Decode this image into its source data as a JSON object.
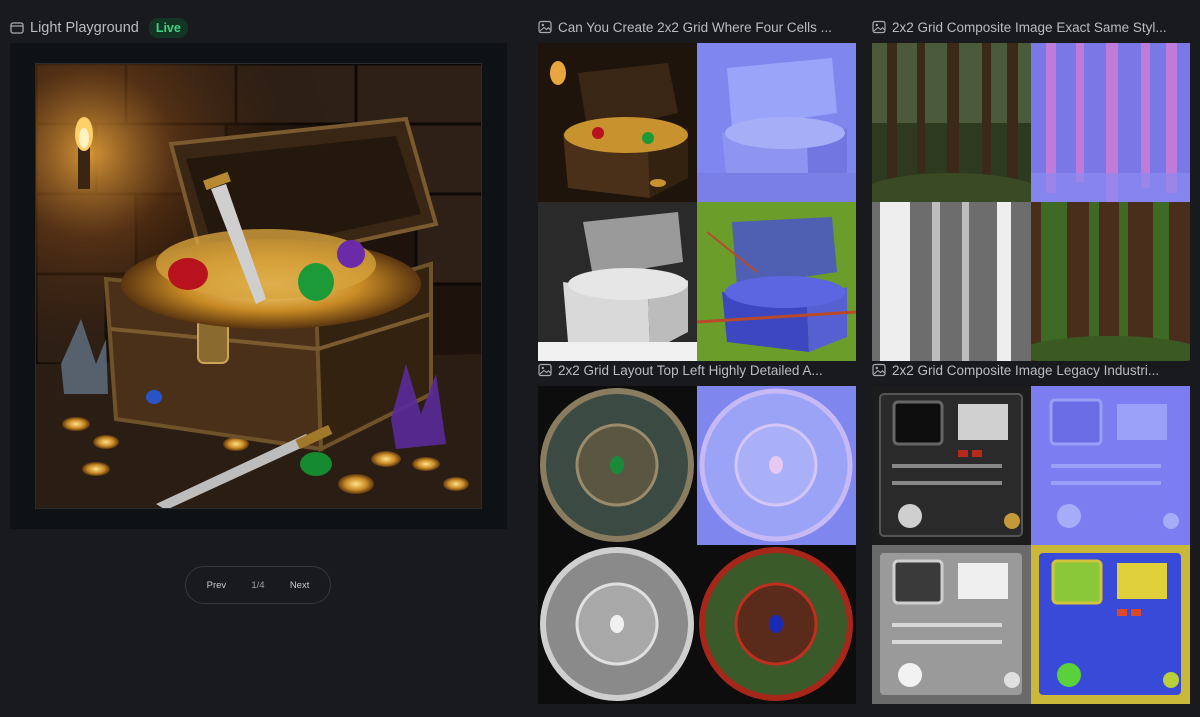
{
  "playground": {
    "title": "Light Playground",
    "badge": "Live"
  },
  "pager": {
    "prev_label": "Prev",
    "page_indicator": "1/4",
    "next_label": "Next"
  },
  "gallery": {
    "cards": [
      {
        "title": "Can You Create 2x2 Grid Where Four Cells ..."
      },
      {
        "title": "2x2 Grid Composite Image Exact Same Styl..."
      },
      {
        "title": "2x2 Grid Layout Top Left Highly Detailed A..."
      },
      {
        "title": "2x2 Grid Composite Image Legacy Industri..."
      }
    ]
  },
  "colors": {
    "background": "#181a1d",
    "stage": "#0f1215",
    "live_badge_bg": "#123524",
    "live_badge_text": "#3fd27f",
    "normal_map": "#7b7df0",
    "roughness_green": "#6a9d2a"
  }
}
